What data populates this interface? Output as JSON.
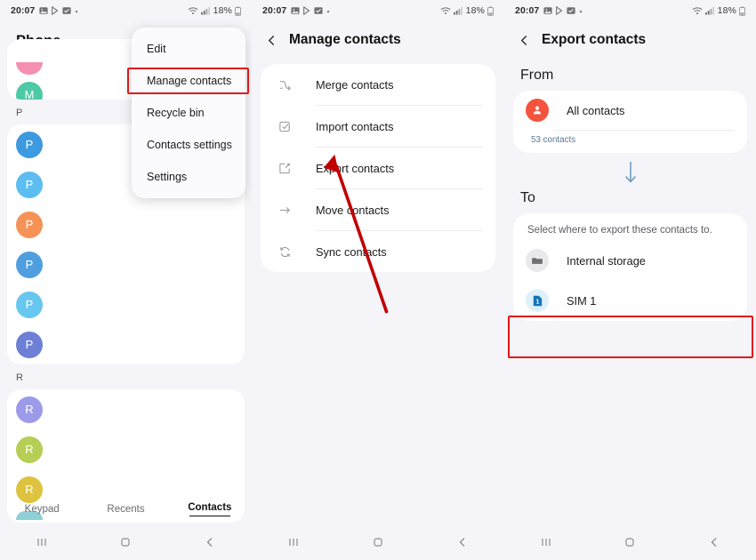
{
  "statusbar": {
    "time": "20:07",
    "icons": [
      "image-icon",
      "play-store-icon",
      "checkbox-icon",
      "dot-icon"
    ],
    "wifi": "wifi-icon",
    "signal": "signal-icon",
    "battery_text": "18%",
    "battery_icon": "battery-icon"
  },
  "panel1": {
    "title": "Phone",
    "sections": [
      {
        "letter": "",
        "contacts": [
          {
            "initial": "",
            "color": "#f48fb1"
          },
          {
            "initial": "M",
            "color": "#4ec9a5"
          }
        ]
      },
      {
        "letter": "P",
        "contacts": [
          {
            "initial": "P",
            "color": "#3d9ae0"
          },
          {
            "initial": "P",
            "color": "#5cbdf0"
          },
          {
            "initial": "P",
            "color": "#f59356"
          },
          {
            "initial": "P",
            "color": "#4f9fe0"
          },
          {
            "initial": "P",
            "color": "#67c7ef"
          },
          {
            "initial": "P",
            "color": "#6e7fd6"
          }
        ]
      },
      {
        "letter": "R",
        "contacts": [
          {
            "initial": "R",
            "color": "#9b9bea"
          },
          {
            "initial": "R",
            "color": "#b5ce55"
          },
          {
            "initial": "R",
            "color": "#ddc33e"
          },
          {
            "initial": "",
            "color": "#8fd0d8"
          }
        ]
      }
    ],
    "menu": {
      "items": [
        {
          "label": "Edit"
        },
        {
          "label": "Manage contacts"
        },
        {
          "label": "Recycle bin"
        },
        {
          "label": "Contacts settings"
        },
        {
          "label": "Settings"
        }
      ],
      "highlighted_index": 1,
      "highlight_color": "#e01818"
    },
    "tabs": [
      {
        "label": "Keypad",
        "active": false
      },
      {
        "label": "Recents",
        "active": false
      },
      {
        "label": "Contacts",
        "active": true
      }
    ],
    "navbar": [
      "recents-icon",
      "home-icon",
      "back-icon"
    ]
  },
  "panel2": {
    "back": "back-chevron-icon",
    "title": "Manage contacts",
    "items": [
      {
        "label": "Merge contacts",
        "icon": "merge-icon"
      },
      {
        "label": "Import contacts",
        "icon": "import-icon"
      },
      {
        "label": "Export contacts",
        "icon": "export-icon"
      },
      {
        "label": "Move contacts",
        "icon": "move-arrow-icon"
      },
      {
        "label": "Sync contacts",
        "icon": "sync-icon"
      }
    ],
    "annotation_arrow": {
      "color": "#c00000",
      "points_to": "Export contacts"
    },
    "navbar": [
      "recents-icon",
      "home-icon",
      "back-icon"
    ]
  },
  "panel3": {
    "back": "back-chevron-icon",
    "title": "Export contacts",
    "from_label": "From",
    "from": {
      "label": "All contacts",
      "icon": "person-icon",
      "icon_color": "#f4533d",
      "count": "53 contacts"
    },
    "flow_arrow": "down-arrow-icon",
    "to_label": "To",
    "to_hint": "Select where to export these contacts to.",
    "to_options": [
      {
        "label": "Internal storage",
        "icon": "folder-icon",
        "highlighted": false
      },
      {
        "label": "SIM 1",
        "icon": "sim-card-icon",
        "highlighted": true
      }
    ],
    "highlight_color": "#e01818",
    "navbar": [
      "recents-icon",
      "home-icon",
      "back-icon"
    ]
  }
}
